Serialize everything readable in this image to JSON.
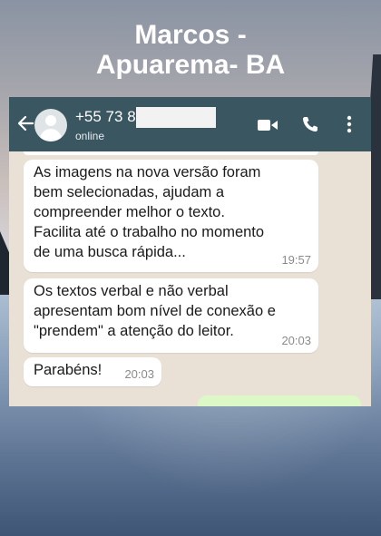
{
  "headline": {
    "line1": "Marcos -",
    "line2": "Apuarema- BA"
  },
  "chat_header": {
    "back_icon": "arrow-left-icon",
    "contact_number": "+55 73 8",
    "status": "online",
    "actions": [
      "video-call-icon",
      "phone-call-icon",
      "more-vert-icon"
    ]
  },
  "messages": [
    {
      "lines": [
        "As imagens na nova versão foram",
        "bem selecionadas, ajudam a",
        "compreender melhor o texto.",
        "Facilita até o trabalho no momento",
        "de uma busca rápida..."
      ],
      "time": "19:57"
    },
    {
      "lines": [
        "Os textos verbal e não verbal",
        "apresentam bom nível de conexão e",
        "\"prendem\" a atenção do leitor."
      ],
      "time": "20:03"
    },
    {
      "lines": [
        "Parabéns!"
      ],
      "time": "20:03"
    }
  ],
  "colors": {
    "header_bg": "#3a5661",
    "chat_bg": "#e9e1d6",
    "incoming_bubble": "#ffffff",
    "outgoing_bubble": "#dcf8c6"
  }
}
